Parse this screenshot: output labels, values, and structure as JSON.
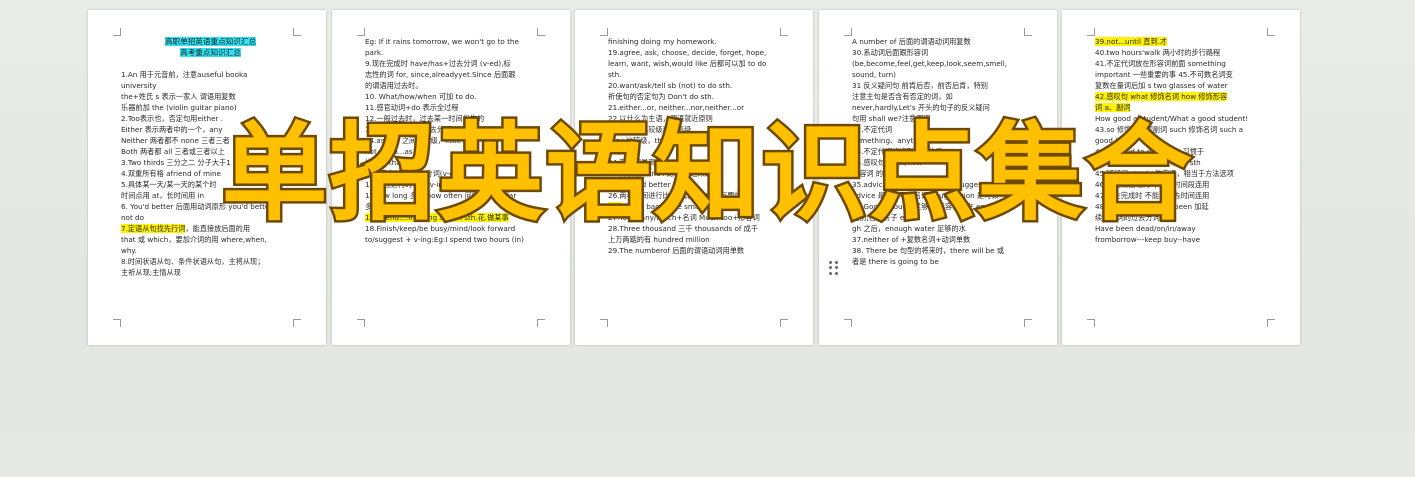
{
  "overlay": {
    "title": "单招英语知识点集合"
  },
  "pages": [
    {
      "title_lines": [
        "高职单招英语重点知识汇总",
        "高考重点知识汇总"
      ],
      "lines": [
        {
          "text": "1.An 用于元音前，注意auseful booka"
        },
        {
          "text": "university"
        },
        {
          "text": "the+姓氏 s 表示一家人 谓语用复数"
        },
        {
          "text": "乐器前加 the (violin guitar piano)"
        },
        {
          "text": "2.Too表示也，否定句用either ."
        },
        {
          "text": "Either 表示两者中的一个，any"
        },
        {
          "text": "Neither 两者都不  none 三者三者"
        },
        {
          "text": "Both 两者都 all 三者或三者以上"
        },
        {
          "text": "3.Two thirds 三分之二 分子大于1"
        },
        {
          "text": "4.双重所有格 afriend of mine"
        },
        {
          "text": "5.具体某一天/某一天的某个时"
        },
        {
          "text": "时间点用 at，长时间用 in"
        },
        {
          "text": "6. You'd better 后面用动词原形 you'd better"
        },
        {
          "text": "not do"
        },
        {
          "text": "7.定语从句找先行词，能直接放后面的用",
          "hl": "7.定语从句找先行词"
        },
        {
          "text": "that 或 which，要加介词的用 where,when,"
        },
        {
          "text": "why."
        },
        {
          "text": "8.时间状语从句、条件状语从句，主将从现；"
        },
        {
          "text": "主祈从现;主情从现"
        }
      ]
    },
    {
      "lines": [
        {
          "text": "Eg: If it rains tomorrow, we won't go to the"
        },
        {
          "text": "park."
        },
        {
          "text": "9.现在完成时 have/has+过去分词 (v-ed),标"
        },
        {
          "text": "志性的词 for, since,alreadyyet.Since 后面跟"
        },
        {
          "text": "的谓语用过去时。"
        },
        {
          "text": "10. What/how/when 可加 to do."
        },
        {
          "text": "11.感官动词+do 表示全过程"
        },
        {
          "text": "12.一般过去时，过去某一时间发生的"
        },
        {
          "text": "13.被动语态 be+过去分词"
        },
        {
          "text": "14.as...as 之间用原级，little"
        },
        {
          "text": "not as/so...as"
        },
        {
          "text": "比较级 than"
        },
        {
          "text": "被动语态 be+过去分词(v-ed)"
        },
        {
          "text": "15.现在进行时 be+v-ing"
        },
        {
          "text": "16How long 多久 how often 问频率 How far"
        },
        {
          "text": "多远"
        },
        {
          "text": "17.Spend....in doing sth/on sth.花.做某事",
          "hl": "17.Spend....in doing sth/on sth.花.做某事"
        },
        {
          "text": "18.Finish/keep/be busy/mind/look forward"
        },
        {
          "text": "to/suggest + v-ing:Eg:I spend two hours (in)"
        }
      ]
    },
    {
      "lines": [
        {
          "text": "finishing doing my homework."
        },
        {
          "text": "19.agree, ask, choose, decide, forget, hope,"
        },
        {
          "text": "learn, want, wish,would like 后都可以加 to do"
        },
        {
          "text": "sth."
        },
        {
          "text": "20.want/ask/tell sb (not) to do sth."
        },
        {
          "text": "祈使句的否定句为 Don't do sth."
        },
        {
          "text": "21.either...or, neither...nor,neither...or"
        },
        {
          "text": "22.以什么为主语，谓语就近原则"
        },
        {
          "text": "23.形容词比较级和最高级"
        },
        {
          "text": "the+比较级，the+比较级"
        },
        {
          "text": "越来越"
        },
        {
          "text": "24.形容词最高级"
        },
        {
          "text": "25.比较级+and+比较级 越来越"
        },
        {
          "text": "Better and better 越来越"
        },
        {
          "text": "26.两者之间进行比较，比较级前面有要加"
        },
        {
          "text": "the.Eg.My bag is the smaller of that two.",
          "hl": "the."
        },
        {
          "text": "27.Too many/much+名词 Much too+形容词"
        },
        {
          "text": "28.Three thousand 三千 thousands of 成千"
        },
        {
          "text": "上万两踮的有 hundred million"
        },
        {
          "text": "29.The numberof 后面的谓语动词用单数"
        }
      ]
    },
    {
      "lines": [
        {
          "text": "A number of 后面的谓语动词用复数"
        },
        {
          "text": "30.系动词后面跟形容词"
        },
        {
          "text": "(be,become,feel,get,keep,look,seem,smell,"
        },
        {
          "text": "sound, turn)"
        },
        {
          "text": "31 反义疑问句 前肯后否，前否后肯，特别"
        },
        {
          "text": "注意主句是否含有否定的词，如"
        },
        {
          "text": "never,hardly.Let's 开头的句子的反义疑问"
        },
        {
          "text": "句用 shall we?注意都用"
        },
        {
          "text": "32.不定代词"
        },
        {
          "text": "something、anything"
        },
        {
          "text": "33.不定代词修饰形容词放后"
        },
        {
          "text": "34.感叹句 what/how"
        },
        {
          "text": "形容词 的用法"
        },
        {
          "text": "35.advice 建议 是不可数名词，suggestion 是可数"
        },
        {
          "text": "advice 是个不可数名词，suggestion 是可数"
        },
        {
          "text": "36.Good enough.足够好,形容词放在 enough"
        },
        {
          "text": "之前;名词房子 enou"
        },
        {
          "text": "gh 之后，enough water 足够的水"
        },
        {
          "text": "37.neither of +复数名词+动词单数"
        },
        {
          "text": "38. There be 句型的将来时，there will be 或"
        },
        {
          "text": "者是 there is going to be"
        }
      ]
    },
    {
      "lines": [
        {
          "text": "39.not...until 直到.才",
          "hl": "39.not...until 直到.才"
        },
        {
          "text": "40.two hours'walk 两小时的步行路程"
        },
        {
          "text": "41.不定代词放在形容词前面 something"
        },
        {
          "text": "important 一些重要的事 45.不可数名词变"
        },
        {
          "text": "复数在量词后加 s two glasses of water"
        },
        {
          "text": "42.感叹句 what 修饰名词 how 修饰形容",
          "hl": "42.感叹句 what 修饰名词 how 修饰形容"
        },
        {
          "text": "词 a、副词",
          "hl": "词 a、副词"
        },
        {
          "text": "How good a student/What a good student!"
        },
        {
          "text": "43.so 修饰形容词副词 such 修饰名词 such a"
        },
        {
          "text": "good boy"
        },
        {
          "text": "44.be used to doing sth 习惯于"
        },
        {
          "text": "used to do sth 过去常常 To sth"
        },
        {
          "text": "45.疑问词+to do 做宾语，相当于方法选项"
        },
        {
          "text": "46.非延续性动词 不能与时间段连用"
        },
        {
          "text": "47.现在完成时 不能与过去时间连用"
        },
        {
          "text": "48.延续性动词 如 have been 加延"
        },
        {
          "text": "续性动词的过去分词"
        },
        {
          "text": "Have been dead/on/in/away"
        },
        {
          "text": "fromborrow---keep buy--have"
        }
      ]
    }
  ]
}
